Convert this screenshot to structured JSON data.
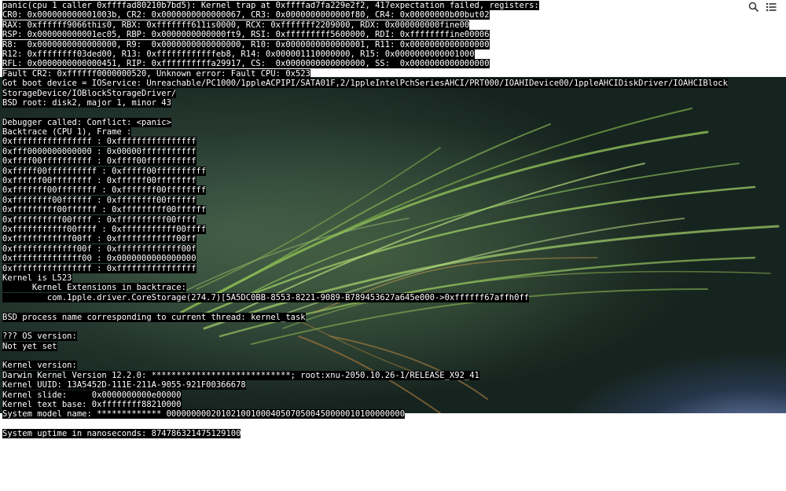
{
  "colors": {
    "console_bg": "#000000",
    "console_text": "#ffffff",
    "page_bg": "#ffffff"
  },
  "menubar": {
    "icons": [
      "search-icon",
      "list-icon"
    ]
  },
  "console": {
    "lines": [
      {
        "text": "panic(cpu 1 caller 0xffffad80210b7bd5): Kernel trap at 0xffffad7fa229e2f2, 417expectation failed, registers:",
        "bg": true
      },
      {
        "text": "CR0: 0x000000000001003b, CR2: 0x0000000000000067, CR3: 0x0000000000000f80, CR4: 0x00000000b00but02",
        "bg": true
      },
      {
        "text": "RAX: 0xffffff9066this0, RBX: 0xfffffff611is0000, RCX: 0xfffffff2209000, RDX: 0x000000000fine00",
        "bg": true
      },
      {
        "text": "RSP: 0x000000000001ec05, RBP: 0x0000000000000ft9, RSI: 0xfffffffff5600000, RDI: 0xffffffffine00006",
        "bg": true
      },
      {
        "text": "R8:  0x0000000000000000, R9:  0x0000000000000000, R10: 0x0000000000000001, R11: 0x0000000000000000",
        "bg": true
      },
      {
        "text": "R12: 0xffffffff03ded00, R13: 0xffffffffffffeb8, R14: 0x000001110000000, R15: 0x0000000000001000",
        "bg": true
      },
      {
        "text": "RFL: 0x0000000000000451, RIP: 0xffffffffffa29917, CS:  0x0000000000000000, SS:  0x0000000000000000",
        "bg": true
      },
      {
        "text": "Fault CR2: 0xffffff0000000520, Unknown error: Fault CPU: 0x523",
        "bg": true
      },
      {
        "text": "Got boot device = IOService: Unreachable/PC1000/1ppleACPIPI/SATA01F,2/1ppleIntelPchSeriesAHCI/PRT000/IOAHIDevice00/1ppleAHCIDiskDriver/IOAHCIBlock",
        "bg": true
      },
      {
        "text": "StorageDevice/IOBlockStorageDriver/",
        "bg": true
      },
      {
        "text": "BSD root: disk2, major 1, minor 43",
        "bg": true
      },
      {
        "text": "",
        "bg": false
      },
      {
        "text": "Debugger called: Conflict: <panic>",
        "bg": true
      },
      {
        "text": "Backtrace (CPU 1), Frame :",
        "bg": true
      },
      {
        "text": "0xffffffffffffffff : 0xffffffffffffffff",
        "bg": true
      },
      {
        "text": "0xfff0000000000000 : 0x00000fffffffffff",
        "bg": true
      },
      {
        "text": "0xffff00ffffffffff : 0xffff00ffffffffff",
        "bg": true
      },
      {
        "text": "0xfffff00ffffffffff : 0xfffff00ffffffffff",
        "bg": true
      },
      {
        "text": "0xffffff00ffffffff : 0xffffff00ffffffff",
        "bg": true
      },
      {
        "text": "0xfffffff00ffffffff : 0xfffffff00ffffffff",
        "bg": true
      },
      {
        "text": "0xffffffff00ffffff : 0xffffffff00ffffff",
        "bg": true
      },
      {
        "text": "0xfffffffff00ffffff : 0xfffffffff00ffffff",
        "bg": true
      },
      {
        "text": "0xffffffffff00ffff : 0xffffffffff00ffff",
        "bg": true
      },
      {
        "text": "0xfffffffffff00ffff : 0xfffffffffff00ffff",
        "bg": true
      },
      {
        "text": "0xffffffffffff00ff : 0xffffffffffff00ff",
        "bg": true
      },
      {
        "text": "0xfffffffffffff00f : 0xfffffffffffff00f",
        "bg": true
      },
      {
        "text": "0xffffffffffffff00 : 0x0000000000000000",
        "bg": true
      },
      {
        "text": "0xffffffffffffffff : 0xffffffffffffffff",
        "bg": true
      },
      {
        "text": "Kernel is L523",
        "bg": true
      },
      {
        "text": "      Kernel Extensions in backtrace:",
        "bg": true
      },
      {
        "text": "         com.1pple.driver.CoreStorage(274.7)[5A5DC0BB-8553-8221-9089-B789453627a645e000->0xffffff67affh0ff",
        "bg": true
      },
      {
        "text": "",
        "bg": false
      },
      {
        "text": "BSD process name corresponding to current thread: kernel_task",
        "bg": true
      },
      {
        "text": "",
        "bg": false
      },
      {
        "text": "??? OS version:",
        "bg": true
      },
      {
        "text": "Not yet set",
        "bg": true
      },
      {
        "text": "",
        "bg": false
      },
      {
        "text": "Kernel version:",
        "bg": true
      },
      {
        "text": "Darwin Kernel Version 12.2.0: ****************************; root:xnu-2050.10.26-1/RELEASE_X92_41",
        "bg": true
      },
      {
        "text": "Kernel UUID: 13A5452D-111E-211A-9055-921F00366678",
        "bg": true
      },
      {
        "text": "Kernel slide:     0x0000000000e00000",
        "bg": true
      },
      {
        "text": "Kernel text base: 0xffffffff88210000",
        "bg": true
      },
      {
        "text": "System model name: ************* 000000000201021001000405070500450000010100000000",
        "bg": true
      },
      {
        "text": "",
        "bg": false
      },
      {
        "text": "System uptime in nanoseconds: 874786321475129100",
        "bg": true
      }
    ]
  }
}
